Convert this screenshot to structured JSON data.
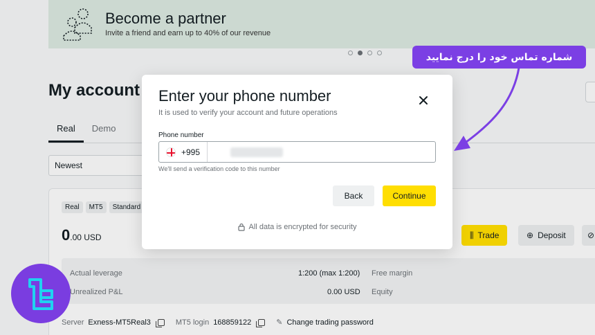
{
  "banner": {
    "title": "Become a partner",
    "subtitle": "Invite a friend and earn up to 40% of our revenue"
  },
  "page": {
    "title": "My account",
    "tabs": [
      "Real",
      "Demo"
    ],
    "active_tab": "Real",
    "sort_value": "Newest"
  },
  "account": {
    "badges": [
      "Real",
      "MT5",
      "Standard"
    ],
    "balance_int": "0",
    "balance_dec": ".00 USD",
    "trade_label": "Trade",
    "deposit_label": "Deposit",
    "stats": {
      "leverage_label": "Actual leverage",
      "leverage_value": "1:200 (max 1:200)",
      "pnl_label": "Unrealized P&L",
      "pnl_value": "0.00 USD",
      "free_margin_label": "Free margin",
      "equity_label": "Equity"
    },
    "footer": {
      "server_label": "Server",
      "server_value": "Exness-MT5Real3",
      "login_label": "MT5 login",
      "login_value": "168859122",
      "change_password": "Change trading password"
    }
  },
  "modal": {
    "title": "Enter your phone number",
    "subtitle": "It is used to verify your account and future operations",
    "field_label": "Phone number",
    "dial_code": "+995",
    "phone_value": "",
    "hint": "We'll send a verification code to this number",
    "back_label": "Back",
    "continue_label": "Continue",
    "security_note": "All data is encrypted for security"
  },
  "annotation": {
    "text": "شماره تماس خود را درج نمایید",
    "color": "#7b3fe4"
  },
  "colors": {
    "accent_yellow": "#ffde02",
    "annotation_purple": "#7b3fe4",
    "banner_green": "#d9e7df"
  },
  "icons": {
    "close": "close-icon",
    "lock": "lock-icon",
    "flag": "georgia-flag-icon",
    "arrow": "curved-arrow-icon"
  }
}
